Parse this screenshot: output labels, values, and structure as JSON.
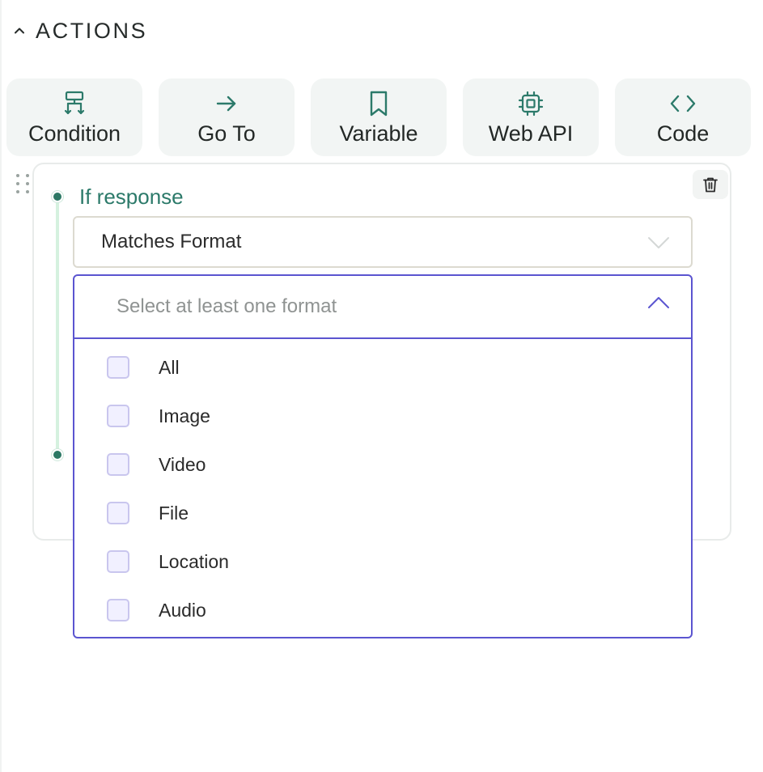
{
  "section": {
    "title": "ACTIONS",
    "icon": "chevron-up-icon"
  },
  "actions": [
    {
      "label": "Condition",
      "icon": "condition-icon"
    },
    {
      "label": "Go To",
      "icon": "arrow-right-icon"
    },
    {
      "label": "Variable",
      "icon": "bookmark-icon"
    },
    {
      "label": "Web API",
      "icon": "chip-icon"
    },
    {
      "label": "Code",
      "icon": "code-icon"
    }
  ],
  "condition": {
    "label": "If response",
    "operator": "Matches Format",
    "format_placeholder": "Select at least one format",
    "options": [
      "All",
      "Image",
      "Video",
      "File",
      "Location",
      "Audio"
    ]
  },
  "colors": {
    "accent_green": "#2c7a6a",
    "dropdown_border": "#5b55d0",
    "tile_bg": "#f2f5f4"
  }
}
